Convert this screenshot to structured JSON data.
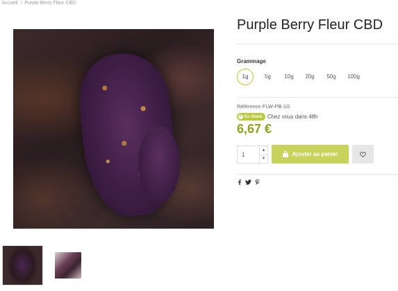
{
  "breadcrumb": {
    "home": "Accueil",
    "separator": "/",
    "current": "Purple Berry Fleur CBD"
  },
  "product": {
    "title": "Purple Berry Fleur CBD",
    "grammage_label": "Grammage",
    "sizes": [
      "1g",
      "5g",
      "10g",
      "20g",
      "50g",
      "100g"
    ],
    "selected_size": "1g",
    "reference": "Référence FLW-PB-1G",
    "stock_badge": "En Stock",
    "delivery": "Chez vous dans 48h",
    "price": "6,67 €",
    "quantity": "1",
    "add_to_cart": "Ajouter au panier"
  },
  "images": {
    "main": "purple-berry-bud-photo",
    "thumbnails": [
      "purple-bud-thumbnail",
      "packaged-flower-thumbnail"
    ]
  },
  "social": [
    "facebook-icon",
    "twitter-icon",
    "pinterest-icon"
  ],
  "colors": {
    "accent": "#8fa21d",
    "button": "#c7d45b",
    "badge": "#b7c83a"
  }
}
